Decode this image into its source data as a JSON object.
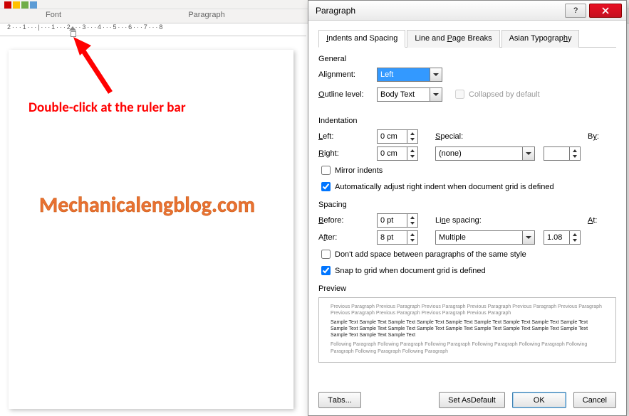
{
  "ribbon": {
    "font_label": "Font",
    "paragraph_label": "Paragraph"
  },
  "ruler_text": "2 · · · 1 · · · | · · · 1 · · · 2 · · · 3 · · · 4 · · · 5 · · · 6 · · · 7 · · · 8",
  "annot": {
    "line1": "Double-click at the ruler bar",
    "watermark": "Mechanicalengblog.com"
  },
  "dialog": {
    "title": "Paragraph",
    "tabs": {
      "indents": "Indents and Spacing",
      "linepage": "Line and Page Breaks",
      "asian": "Asian Typography"
    },
    "general": {
      "heading": "General",
      "alignment_label": "Alignment:",
      "alignment_value": "Left",
      "outline_label": "Outline level:",
      "outline_value": "Body Text",
      "collapsed_label": "Collapsed by default"
    },
    "indent": {
      "heading": "Indentation",
      "left_label": "Left:",
      "left_value": "0 cm",
      "right_label": "Right:",
      "right_value": "0 cm",
      "special_label": "Special:",
      "special_value": "(none)",
      "by_label": "By:",
      "by_value": "",
      "mirror_label": "Mirror indents",
      "auto_label": "Automatically adjust right indent when document grid is defined"
    },
    "spacing": {
      "heading": "Spacing",
      "before_label": "Before:",
      "before_value": "0 pt",
      "after_label": "After:",
      "after_value": "8 pt",
      "lsp_label": "Line spacing:",
      "lsp_value": "Multiple",
      "at_label": "At:",
      "at_value": "1.08",
      "dontadd_label": "Don't add space between paragraphs of the same style",
      "snap_label": "Snap to grid when document grid is defined"
    },
    "preview": {
      "heading": "Preview",
      "prev_text": "Previous Paragraph Previous Paragraph Previous Paragraph Previous Paragraph Previous Paragraph Previous Paragraph Previous Paragraph Previous Paragraph Previous Paragraph Previous Paragraph",
      "sample_text": "Sample Text Sample Text Sample Text Sample Text Sample Text Sample Text Sample Text Sample Text Sample Text Sample Text Sample Text Sample Text Sample Text Sample Text Sample Text Sample Text Sample Text Sample Text Sample Text Sample Text Sample Text",
      "foll_text": "Following Paragraph Following Paragraph Following Paragraph Following Paragraph Following Paragraph Following Paragraph Following Paragraph Following Paragraph"
    },
    "buttons": {
      "tabs": "Tabs...",
      "default": "Set As Default",
      "ok": "OK",
      "cancel": "Cancel"
    }
  }
}
